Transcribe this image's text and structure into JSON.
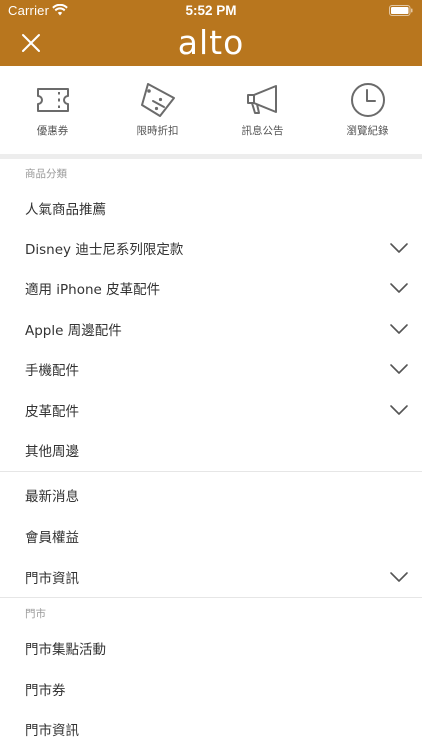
{
  "status_bar": {
    "carrier": "Carrier",
    "time": "5:52 PM"
  },
  "nav": {
    "brand": "alto",
    "close_icon": "close-icon"
  },
  "quick_actions": [
    {
      "label": "優惠券",
      "icon": "coupon-ticket-icon"
    },
    {
      "label": "限時折扣",
      "icon": "discount-tag-icon"
    },
    {
      "label": "訊息公告",
      "icon": "megaphone-icon"
    },
    {
      "label": "瀏覽紀錄",
      "icon": "clock-history-icon"
    }
  ],
  "sections": [
    {
      "header": "商品分類",
      "items": [
        {
          "label": "人氣商品推薦",
          "expandable": false
        },
        {
          "label": "Disney 迪士尼系列限定款",
          "expandable": true
        },
        {
          "label": "適用 iPhone 皮革配件",
          "expandable": true
        },
        {
          "label": "Apple 周邊配件",
          "expandable": true
        },
        {
          "label": "手機配件",
          "expandable": true
        },
        {
          "label": "皮革配件",
          "expandable": true
        },
        {
          "label": "其他周邊",
          "expandable": false
        }
      ]
    },
    {
      "header": "",
      "items": [
        {
          "label": "最新消息",
          "expandable": false
        },
        {
          "label": "會員權益",
          "expandable": false
        },
        {
          "label": "門市資訊",
          "expandable": true
        }
      ]
    },
    {
      "header": "門市",
      "items": [
        {
          "label": "門市集點活動",
          "expandable": false
        },
        {
          "label": "門市券",
          "expandable": false
        },
        {
          "label": "門市資訊",
          "expandable": false
        }
      ]
    }
  ],
  "colors": {
    "brand": "#b8761e",
    "icon_gray": "#6b6b6b",
    "text": "#333333",
    "section_header": "#9a9a9a",
    "divider": "#e6e6e6"
  }
}
